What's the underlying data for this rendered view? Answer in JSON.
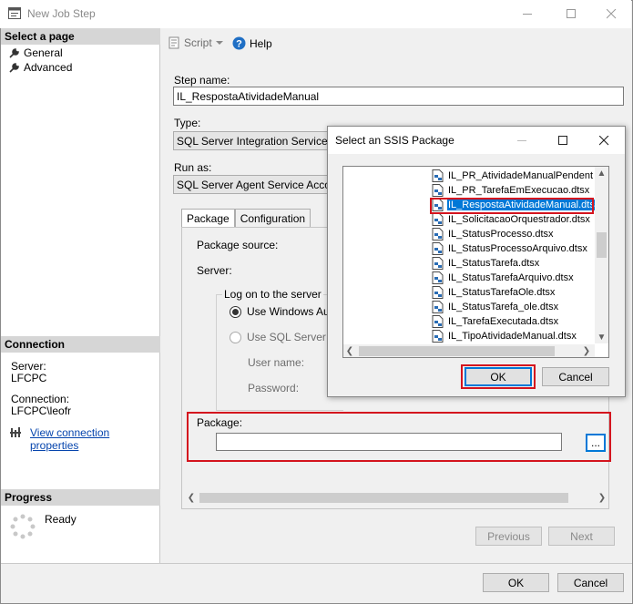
{
  "window": {
    "title": "New Job Step"
  },
  "left": {
    "select_page": "Select a page",
    "nav": [
      {
        "label": "General"
      },
      {
        "label": "Advanced"
      }
    ],
    "connection_header": "Connection",
    "server_label": "Server:",
    "server_value": "LFCPC",
    "connection_label": "Connection:",
    "connection_value": "LFCPC\\leofr",
    "view_connection": "View connection properties",
    "progress_header": "Progress",
    "progress_status": "Ready"
  },
  "toolbar": {
    "script": "Script",
    "help": "Help"
  },
  "form": {
    "step_name_label": "Step name:",
    "step_name_value": "IL_RespostaAtividadeManual",
    "type_label": "Type:",
    "type_value": "SQL Server Integration Services Pa",
    "runas_label": "Run as:",
    "runas_value": "SQL Server Agent Service Account",
    "tabs": [
      {
        "label": "Package"
      },
      {
        "label": "Configuration"
      }
    ],
    "package_source_label": "Package source:",
    "server_label": "Server:",
    "logon_group": "Log on to the server",
    "use_windows": "Use Windows Auth",
    "use_sql": "Use SQL Server A",
    "user_name": "User name:",
    "password": "Password:",
    "package_label": "Package:",
    "package_value": "",
    "browse": "...",
    "previous": "Previous",
    "next": "Next",
    "ok": "OK",
    "cancel": "Cancel"
  },
  "dialog": {
    "title": "Select an SSIS Package",
    "items": [
      {
        "label": "IL_PR_AtividadeManualPendent"
      },
      {
        "label": "IL_PR_TarefaEmExecucao.dtsx"
      },
      {
        "label": "IL_RespostaAtividadeManual.dts"
      },
      {
        "label": "IL_SolicitacaoOrquestrador.dtsx"
      },
      {
        "label": "IL_StatusProcesso.dtsx"
      },
      {
        "label": "IL_StatusProcessoArquivo.dtsx"
      },
      {
        "label": "IL_StatusTarefa.dtsx"
      },
      {
        "label": "IL_StatusTarefaArquivo.dtsx"
      },
      {
        "label": "IL_StatusTarefaOle.dtsx"
      },
      {
        "label": "IL_StatusTarefa_ole.dtsx"
      },
      {
        "label": "IL_TarefaExecutada.dtsx"
      },
      {
        "label": "IL_TipoAtividadeManual.dtsx"
      }
    ],
    "ok": "OK",
    "cancel": "Cancel"
  },
  "colors": {
    "accent": "#0078d7",
    "highlight": "#d4141e",
    "link": "#0645ad"
  }
}
